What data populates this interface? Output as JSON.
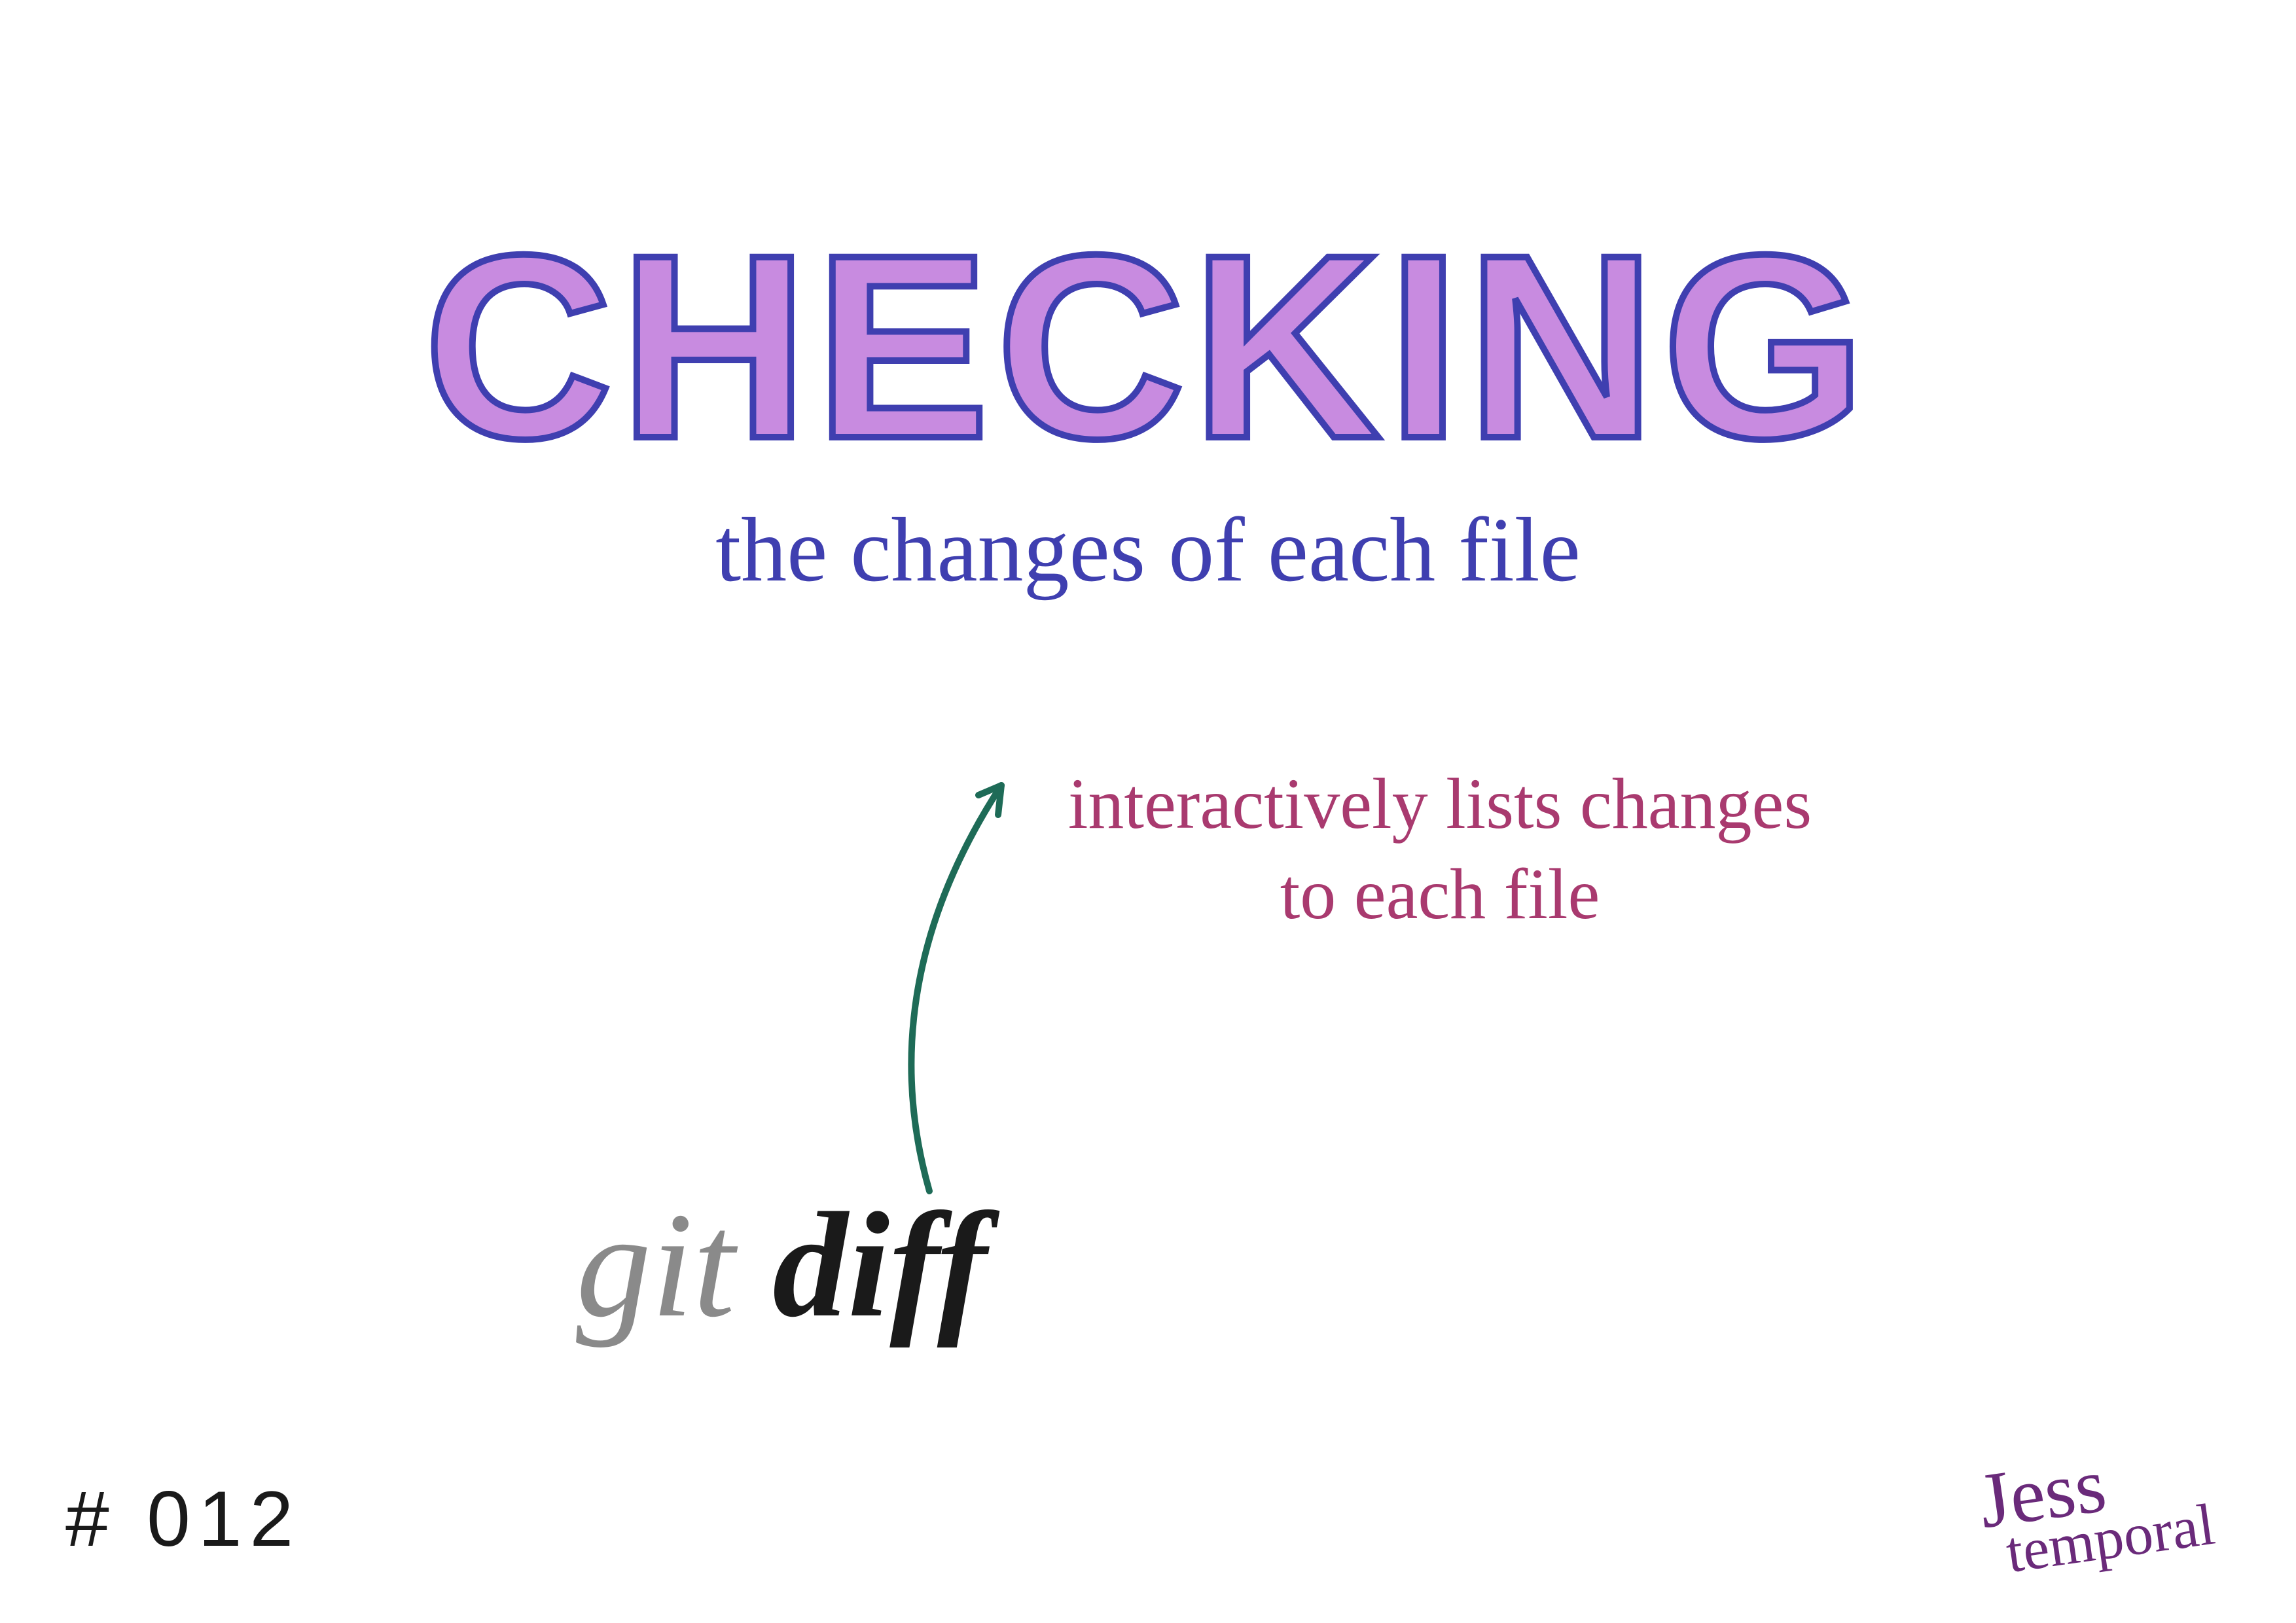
{
  "title": "CHECKING",
  "subtitle": "the changes of each file",
  "annotation": {
    "line1": "interactively lists changes",
    "line2": "to each file"
  },
  "command": {
    "base": "git",
    "subcommand": "diff"
  },
  "card_number": "# 012",
  "signature": {
    "line1": "Jess",
    "line2": "temporal"
  },
  "colors": {
    "title_fill": "#c88be0",
    "title_stroke": "#3f3fb0",
    "subtitle": "#3f3fb0",
    "annotation": "#a93a6f",
    "arrow": "#1e6b57",
    "cmd_base": "#8a8a8a",
    "cmd_sub": "#1a1a1a",
    "signature": "#6a2a7a"
  }
}
